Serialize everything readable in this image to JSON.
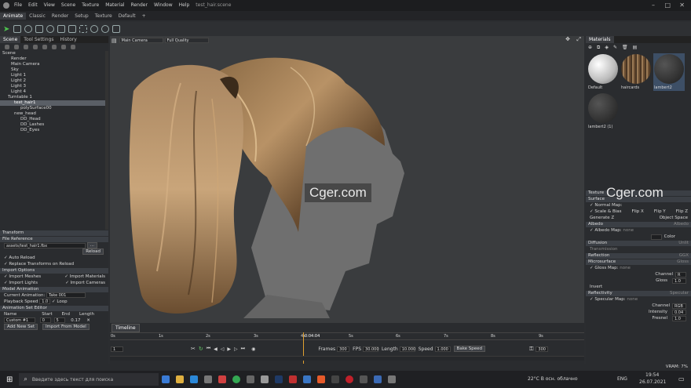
{
  "app": {
    "title": "test_hair.scene",
    "menu": [
      "File",
      "Edit",
      "View",
      "Scene",
      "Texture",
      "Material",
      "Render",
      "Window",
      "Help"
    ]
  },
  "modes": [
    "Animate",
    "Classic",
    "Render",
    "Setup",
    "Texture",
    "Default",
    "+"
  ],
  "left": {
    "tabs": [
      "Scene",
      "Tool Settings",
      "History"
    ],
    "tree": [
      "Scene",
      "Render",
      "Main Camera",
      "Sky",
      "Light 1",
      "Light 2",
      "Light 3",
      "Light 4",
      "Turntable 1",
      "test_hair1",
      "polySurface00",
      "new_head",
      "DD_Head",
      "DD_Lashes",
      "DD_Eyes"
    ],
    "transform": "Transform",
    "file_ref": "File Reference",
    "file_path": "assets/test_hair1.fbx",
    "browse": "...",
    "reload": "Reload",
    "auto_reload": "Auto Reload",
    "replace_transforms": "Replace Transforms on Reload",
    "import_options": "Import Options",
    "import_meshes": "Import Meshes",
    "import_materials": "Import Materials",
    "import_lights": "Import Lights",
    "import_cameras": "Import Cameras",
    "model_animation": "Model Animation",
    "current_animation_label": "Current Animation:",
    "current_animation": "Take 001",
    "playback_speed_label": "Playback Speed",
    "playback_speed": "1.0",
    "loop": "Loop",
    "set_editor": "Animation Set Editor",
    "cols": [
      "Name",
      "Start",
      "End",
      "Length"
    ],
    "set_row": [
      "Custom #1",
      "0",
      "5",
      "0.17"
    ],
    "add_set": "Add New Set",
    "import_model": "Import From Model"
  },
  "viewport": {
    "camera": "Main Camera",
    "quality": "Full Quality",
    "watermark": "Cger.com"
  },
  "timeline": {
    "tab": "Timeline",
    "ticks": [
      "0s",
      "1s",
      "2s",
      "3s",
      "4s",
      "5s",
      "6s",
      "7s",
      "8s",
      "9s"
    ],
    "current": "0:04:04",
    "frames_label": "Frames",
    "frames": "300",
    "fps_label": "FPS",
    "fps": "30.000",
    "length_label": "Length",
    "length": "10.000",
    "speed_label": "Speed",
    "speed": "1.000",
    "bake": "Bake Speed",
    "start_frame": "1",
    "end_frame": "300"
  },
  "right": {
    "tab": "Materials",
    "materials": [
      "Default",
      "haircards",
      "lambert2",
      "lambert2 (1)"
    ],
    "texture": "Texture",
    "surface": "Surface",
    "normal_map": "Normal Map:",
    "scale_bias": "Scale & Bias",
    "flip_x": "Flip X",
    "flip_y": "Flip Y",
    "flip_z": "Flip Z",
    "gen_z": "Generate Z",
    "object_space": "Object Space",
    "albedo": "Albedo",
    "albedo_type": "Albedo",
    "albedo_map": "Albedo Map:",
    "none": "none",
    "color": "Color",
    "diffusion": "Diffusion",
    "diffusion_type": "Unlit",
    "transmission": "Transmission",
    "reflection": "Reflection",
    "reflection_type": "GGX",
    "microsurface": "Microsurface",
    "microsurface_type": "Gloss",
    "gloss_map": "Gloss Map:",
    "channel": "Channel",
    "channel_val": "R",
    "gloss": "Gloss",
    "gloss_val": "1.0",
    "invert": "Invert",
    "reflectivity": "Reflectivity",
    "reflectivity_type": "Specular",
    "specular_map": "Specular Map:",
    "channel_val2": "RGB",
    "intensity": "Intensity",
    "intensity_val": "0.04",
    "fresnel": "Fresnel",
    "fresnel_val": "1.0",
    "watermark": "Cger.com"
  },
  "status": {
    "vram": "VRAM: 7%"
  },
  "taskbar": {
    "search": "Введите здесь текст для поиска",
    "weather": "22°C В осн. облачно",
    "lang": "ENG",
    "time": "19:54",
    "date": "26.07.2021"
  }
}
